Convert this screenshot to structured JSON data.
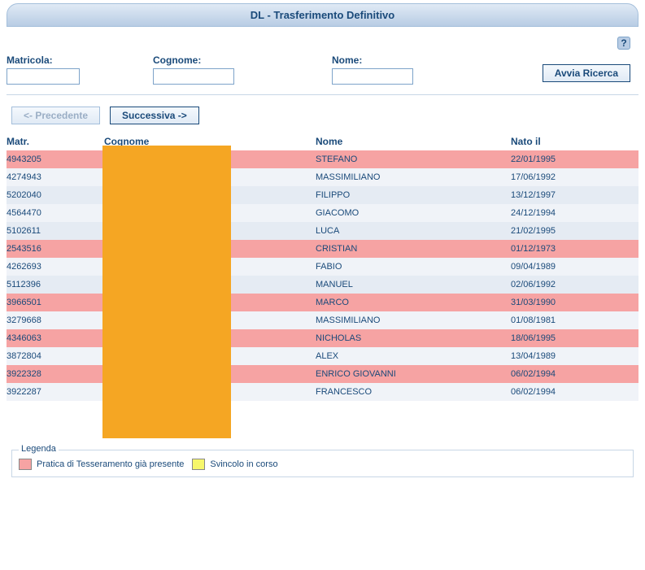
{
  "title": "DL - Trasferimento Definitivo",
  "help": "?",
  "search": {
    "matricola_label": "Matricola:",
    "cognome_label": "Cognome:",
    "nome_label": "Nome:",
    "matricola_value": "",
    "cognome_value": "",
    "nome_value": "",
    "avvia_label": "Avvia Ricerca"
  },
  "pagination": {
    "prev": "<- Precedente",
    "next": "Successiva ->"
  },
  "columns": {
    "matr": "Matr.",
    "cognome": "Cognome",
    "nome": "Nome",
    "nato": "Nato il"
  },
  "rows": [
    {
      "matr": "4943205",
      "cognome": "",
      "nome": "STEFANO",
      "nato": "22/01/1995",
      "status": "pink"
    },
    {
      "matr": "4274943",
      "cognome": "",
      "nome": "MASSIMILIANO",
      "nato": "17/06/1992",
      "status": ""
    },
    {
      "matr": "5202040",
      "cognome": "",
      "nome": "FILIPPO",
      "nato": "13/12/1997",
      "status": "alt"
    },
    {
      "matr": "4564470",
      "cognome": "",
      "nome": "GIACOMO",
      "nato": "24/12/1994",
      "status": ""
    },
    {
      "matr": "5102611",
      "cognome": "",
      "nome": "LUCA",
      "nato": "21/02/1995",
      "status": "alt"
    },
    {
      "matr": "2543516",
      "cognome": "",
      "nome": "CRISTIAN",
      "nato": "01/12/1973",
      "status": "pink"
    },
    {
      "matr": "4262693",
      "cognome": "",
      "nome": "FABIO",
      "nato": "09/04/1989",
      "status": ""
    },
    {
      "matr": "5112396",
      "cognome": "",
      "nome": "MANUEL",
      "nato": "02/06/1992",
      "status": "alt"
    },
    {
      "matr": "3966501",
      "cognome": "",
      "nome": "MARCO",
      "nato": "31/03/1990",
      "status": "pink"
    },
    {
      "matr": "3279668",
      "cognome": "",
      "nome": "MASSIMILIANO",
      "nato": "01/08/1981",
      "status": ""
    },
    {
      "matr": "4346063",
      "cognome": "",
      "nome": "NICHOLAS",
      "nato": "18/06/1995",
      "status": "pink"
    },
    {
      "matr": "3872804",
      "cognome": "",
      "nome": "ALEX",
      "nato": "13/04/1989",
      "status": ""
    },
    {
      "matr": "3922328",
      "cognome": "",
      "nome": "ENRICO GIOVANNI",
      "nato": "06/02/1994",
      "status": "pink"
    },
    {
      "matr": "3922287",
      "cognome": "",
      "nome": "FRANCESCO",
      "nato": "06/02/1994",
      "status": ""
    }
  ],
  "legenda": {
    "title": "Legenda",
    "pratica": "Pratica di Tesseramento già presente",
    "svincolo": "Svincolo in corso"
  }
}
